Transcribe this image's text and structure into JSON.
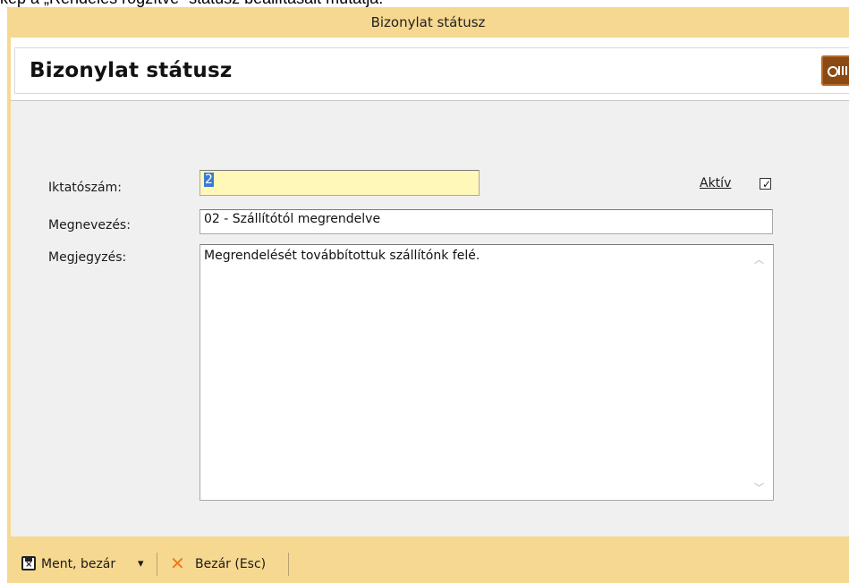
{
  "document": {
    "caption_fragment": "kép a „Rendelés rögzítve” státusz beállításait mutatja."
  },
  "window": {
    "title": "Bizonylat státusz"
  },
  "header": {
    "title": "Bizonylat státusz",
    "icon": "safe-icon",
    "icon_color": "#8b4a14"
  },
  "form": {
    "iktatoszam": {
      "label": "Iktatószám:",
      "value": "2"
    },
    "aktiv": {
      "label": "Aktív",
      "checked": true,
      "mark": "✓"
    },
    "megnevezes": {
      "label": "Megnevezés:",
      "value": "02 - Szállítótól megrendelve"
    },
    "megjegyzes": {
      "label": "Megjegyzés:",
      "value": "Megrendelését továbbítottuk szállítónk felé."
    },
    "scroll_up": "︿",
    "scroll_down": "﹀"
  },
  "toolbar": {
    "save_close_label": "Ment, bezár",
    "save_close_dropdown": "▾",
    "close_label": "Bezár (Esc)",
    "close_icon_glyph": "✕"
  },
  "colors": {
    "frame": "#f7d890",
    "field_highlight": "#fff8b8",
    "selection": "#3a7bd5",
    "close_icon": "#f07818"
  }
}
